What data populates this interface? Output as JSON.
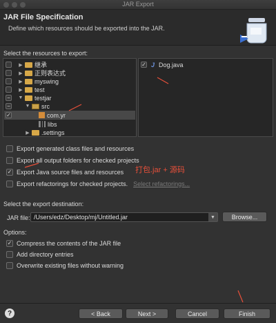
{
  "window": {
    "title": "JAR Export"
  },
  "header": {
    "title": "JAR File Specification",
    "description": "Define which resources should be exported into the JAR."
  },
  "resources": {
    "label": "Select the resources to export:",
    "tree": [
      {
        "label": "继承",
        "check": "",
        "twisty": "▶"
      },
      {
        "label": "正则表达式",
        "check": "",
        "twisty": "▶"
      },
      {
        "label": "myswing",
        "check": "",
        "twisty": "▶"
      },
      {
        "label": "test",
        "check": "",
        "twisty": "▶"
      },
      {
        "label": "testjar",
        "check": "−",
        "twisty": "▼"
      },
      {
        "label": "src",
        "check": "−",
        "twisty": "▼"
      },
      {
        "label": "com.yr",
        "check": "✓",
        "twisty": ""
      },
      {
        "label": "libs",
        "check": "",
        "twisty": ""
      },
      {
        "label": ".settings",
        "check": "",
        "twisty": "▶"
      }
    ],
    "files": [
      {
        "label": "Dog.java",
        "check": "✓",
        "icon": "J"
      }
    ]
  },
  "export_options": [
    {
      "label": "Export generated class files and resources",
      "checked": ""
    },
    {
      "label": "Export all output folders for checked projects",
      "checked": ""
    },
    {
      "label": "Export Java source files and resources",
      "checked": "✓"
    },
    {
      "label": "Export refactorings for checked projects.",
      "checked": "",
      "link": "Select refactorings..."
    }
  ],
  "annotation": "打包.jar + 源码",
  "destination": {
    "label": "Select the export destination:",
    "jar_label": "JAR file:",
    "jar_value": "/Users/edz/Desktop/mj/Untitled.jar",
    "browse": "Browse..."
  },
  "options": {
    "label": "Options:",
    "items": [
      {
        "label": "Compress the contents of the JAR file",
        "checked": "✓"
      },
      {
        "label": "Add directory entries",
        "checked": ""
      },
      {
        "label": "Overwrite existing files without warning",
        "checked": ""
      }
    ]
  },
  "footer": {
    "help": "?",
    "back": "< Back",
    "next": "Next >",
    "cancel": "Cancel",
    "finish": "Finish"
  },
  "colors": {
    "annotation_red": "#e8503a",
    "background": "#323232"
  }
}
